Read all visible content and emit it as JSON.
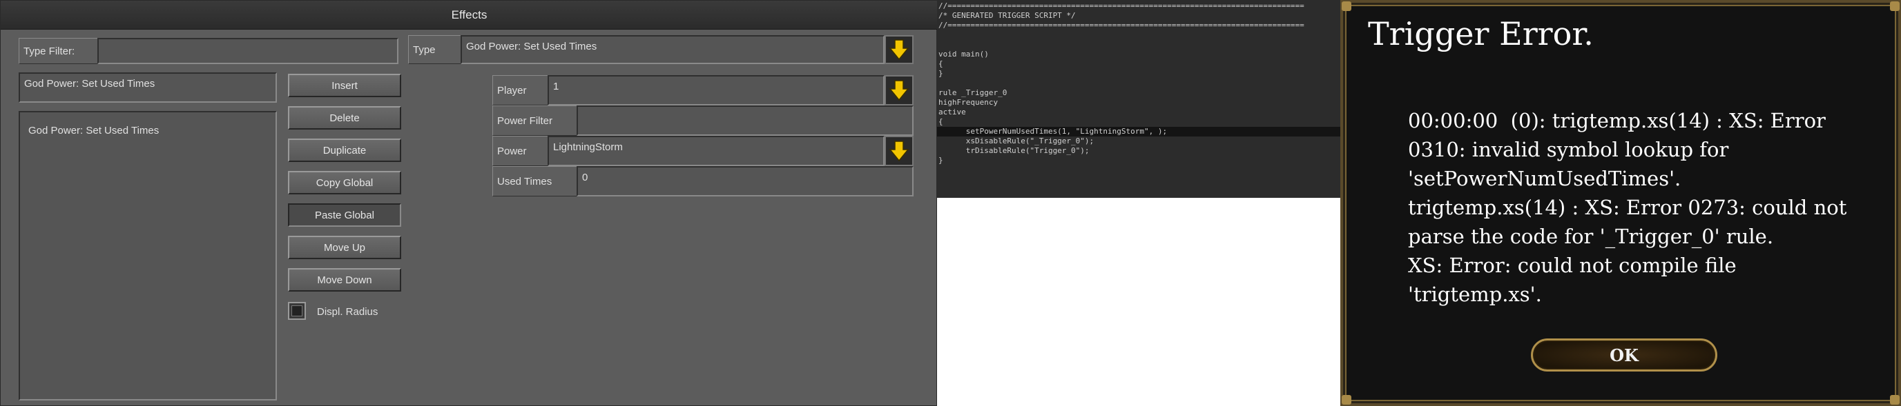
{
  "effects_window": {
    "title": "Effects",
    "type_filter": {
      "label": "Type Filter:",
      "value": ""
    },
    "type": {
      "label": "Type",
      "value": "God Power: Set Used Times"
    },
    "selected_effect": "God Power: Set Used Times",
    "effect_list": [
      "God Power: Set Used Times"
    ],
    "buttons": {
      "insert": "Insert",
      "delete": "Delete",
      "duplicate": "Duplicate",
      "copy_global": "Copy Global",
      "paste_global": "Paste Global",
      "move_up": "Move Up",
      "move_down": "Move Down"
    },
    "displ_radius": {
      "label": "Displ. Radius",
      "checked": false
    },
    "params": {
      "player": {
        "label": "Player",
        "value": "1"
      },
      "power_filter": {
        "label": "Power Filter",
        "value": ""
      },
      "power": {
        "label": "Power",
        "value": "LightningStorm"
      },
      "used_times": {
        "label": "Used Times",
        "value": "0"
      }
    }
  },
  "script": {
    "lines": [
      "//==============================================================================",
      "/* GENERATED TRIGGER SCRIPT */",
      "//==============================================================================",
      "",
      "",
      "void main()",
      "{",
      "}",
      "",
      "rule _Trigger_0",
      "highFrequency",
      "active",
      "{",
      "      setPowerNumUsedTimes(1, \"LightningStorm\", );",
      "      xsDisableRule(\"_Trigger_0\");",
      "      trDisableRule(\"Trigger_0\");",
      "}"
    ],
    "highlighted_line": 13
  },
  "error_dialog": {
    "title": "Trigger Error.",
    "message_lines": [
      "00:00:00  (0): trigtemp.xs(14) : XS: Error",
      "0310: invalid symbol lookup for",
      "'setPowerNumUsedTimes'.",
      "trigtemp.xs(14) : XS: Error 0273: could not",
      "parse the code for '_Trigger_0' rule.",
      "XS: Error: could not compile file",
      "'trigtemp.xs'."
    ],
    "ok_label": "OK"
  },
  "colors": {
    "panel_bg": "#5c5c5c",
    "dropdown_arrow": "#f2c500",
    "dialog_bg": "#121212",
    "dialog_border": "#b0904a"
  },
  "icons": {
    "dropdown": "arrow-down-icon"
  }
}
